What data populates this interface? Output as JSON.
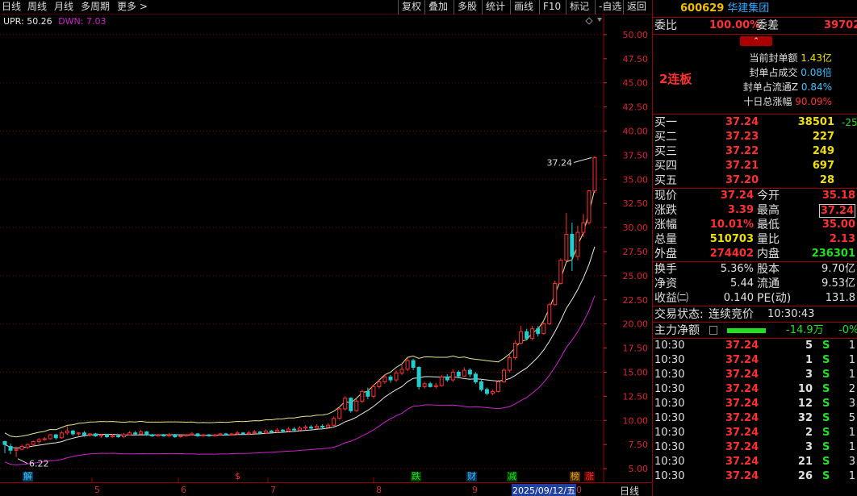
{
  "period_tabs": [
    {
      "label": "日线",
      "active": true
    },
    {
      "label": "周线",
      "active": false
    },
    {
      "label": "月线",
      "active": false
    },
    {
      "label": "多周期",
      "active": false
    },
    {
      "label": "更多 >",
      "active": false
    }
  ],
  "toolbar": [
    "复权",
    "叠加",
    "多股",
    "统计",
    "画线",
    "F10",
    "标记",
    "-自选",
    "返回"
  ],
  "indicator": {
    "upr_label": "UPR: 50.26",
    "dwn_label": "DWN: 7.03"
  },
  "colors": {
    "up": "#ff3030",
    "down": "#20d0d0",
    "upr": "#e8e890",
    "dwn": "#d020d0",
    "grid": "#800000"
  },
  "chart_data": {
    "type": "candlestick",
    "y_ticks": [
      "50.00",
      "47.50",
      "45.00",
      "42.50",
      "40.00",
      "37.50",
      "35.00",
      "32.50",
      "30.00",
      "27.50",
      "25.00",
      "22.50",
      "20.00",
      "17.50",
      "15.00",
      "12.50",
      "10.00",
      "7.50",
      "5.00"
    ],
    "ylim": [
      4.0,
      51.5
    ],
    "x_ticks": [
      "5",
      "6",
      "7",
      "8",
      "9"
    ],
    "last_price_label": "37.24",
    "low_label": "6.22",
    "candles": [
      [
        7.8,
        7.5,
        7.9,
        6.6
      ],
      [
        7.3,
        6.9,
        7.6,
        6.5
      ],
      [
        6.9,
        7.0,
        7.3,
        6.2
      ],
      [
        7.0,
        7.3,
        7.5,
        6.9
      ],
      [
        7.2,
        7.5,
        7.6,
        7.0
      ],
      [
        7.5,
        7.8,
        7.9,
        7.3
      ],
      [
        7.8,
        8.0,
        8.2,
        7.6
      ],
      [
        8.0,
        8.1,
        8.3,
        7.9
      ],
      [
        8.1,
        8.5,
        8.6,
        8.0
      ],
      [
        8.5,
        8.2,
        8.6,
        8.0
      ],
      [
        8.2,
        8.7,
        8.9,
        8.1
      ],
      [
        8.7,
        8.9,
        9.4,
        8.5
      ],
      [
        8.9,
        8.6,
        9.0,
        8.4
      ],
      [
        8.6,
        8.7,
        8.8,
        8.4
      ],
      [
        8.7,
        8.5,
        8.9,
        8.3
      ],
      [
        8.5,
        8.6,
        8.7,
        8.3
      ],
      [
        8.6,
        8.4,
        8.7,
        8.3
      ],
      [
        8.4,
        8.5,
        8.6,
        8.2
      ],
      [
        8.5,
        8.3,
        8.6,
        8.2
      ],
      [
        8.3,
        8.4,
        8.6,
        8.2
      ],
      [
        8.4,
        8.3,
        8.5,
        8.2
      ],
      [
        8.3,
        8.5,
        8.7,
        8.2
      ],
      [
        8.5,
        8.7,
        8.9,
        8.4
      ],
      [
        8.7,
        8.6,
        8.9,
        8.5
      ],
      [
        8.6,
        8.8,
        9.0,
        8.5
      ],
      [
        8.8,
        8.5,
        8.9,
        8.4
      ],
      [
        8.5,
        8.4,
        8.6,
        8.3
      ],
      [
        8.4,
        8.5,
        8.6,
        8.3
      ],
      [
        8.5,
        8.4,
        8.6,
        8.3
      ],
      [
        8.4,
        8.5,
        8.7,
        8.3
      ],
      [
        8.5,
        8.3,
        8.6,
        8.2
      ],
      [
        8.3,
        8.4,
        8.5,
        8.2
      ],
      [
        8.4,
        8.5,
        8.6,
        8.3
      ],
      [
        8.5,
        8.6,
        8.8,
        8.4
      ],
      [
        8.6,
        8.4,
        8.7,
        8.3
      ],
      [
        8.4,
        8.5,
        8.6,
        8.3
      ],
      [
        8.5,
        8.4,
        8.6,
        8.3
      ],
      [
        8.4,
        8.5,
        8.6,
        8.3
      ],
      [
        8.5,
        8.6,
        8.7,
        8.4
      ],
      [
        8.6,
        8.5,
        8.7,
        8.4
      ],
      [
        8.5,
        8.6,
        8.7,
        8.4
      ],
      [
        8.6,
        8.7,
        8.9,
        8.5
      ],
      [
        8.7,
        8.6,
        8.8,
        8.5
      ],
      [
        8.6,
        8.7,
        8.9,
        8.5
      ],
      [
        8.7,
        8.8,
        9.0,
        8.6
      ],
      [
        8.8,
        8.7,
        8.9,
        8.6
      ],
      [
        8.7,
        8.9,
        9.1,
        8.6
      ],
      [
        8.9,
        8.8,
        9.0,
        8.7
      ],
      [
        8.8,
        9.0,
        9.2,
        8.7
      ],
      [
        9.0,
        8.9,
        9.1,
        8.8
      ],
      [
        8.9,
        9.1,
        9.3,
        8.8
      ],
      [
        9.1,
        9.0,
        9.3,
        8.9
      ],
      [
        9.0,
        9.2,
        9.4,
        8.9
      ],
      [
        9.2,
        9.3,
        9.5,
        9.0
      ],
      [
        9.3,
        9.2,
        9.5,
        9.0
      ],
      [
        9.2,
        9.4,
        9.6,
        9.1
      ],
      [
        9.4,
        9.3,
        9.6,
        9.1
      ],
      [
        9.3,
        9.5,
        9.7,
        9.2
      ],
      [
        9.5,
        10.2,
        10.4,
        9.4
      ],
      [
        10.2,
        11.2,
        11.4,
        10.1
      ],
      [
        11.2,
        12.3,
        12.5,
        11.0
      ],
      [
        12.3,
        11.0,
        12.4,
        10.8
      ],
      [
        11.0,
        12.0,
        12.2,
        10.9
      ],
      [
        12.0,
        13.0,
        13.2,
        11.8
      ],
      [
        13.0,
        12.5,
        13.4,
        12.2
      ],
      [
        12.5,
        13.5,
        13.7,
        12.3
      ],
      [
        13.5,
        14.0,
        14.3,
        13.3
      ],
      [
        14.0,
        14.5,
        14.8,
        13.8
      ],
      [
        14.5,
        14.2,
        14.7,
        13.9
      ],
      [
        14.2,
        14.9,
        15.2,
        14.0
      ],
      [
        14.9,
        15.3,
        15.7,
        14.7
      ],
      [
        15.3,
        16.2,
        16.5,
        15.1
      ],
      [
        16.2,
        15.5,
        16.4,
        15.2
      ],
      [
        15.5,
        13.5,
        15.6,
        13.2
      ],
      [
        13.5,
        13.8,
        14.0,
        13.3
      ],
      [
        13.8,
        13.5,
        14.0,
        13.4
      ],
      [
        13.5,
        13.6,
        13.9,
        13.3
      ],
      [
        13.6,
        14.5,
        14.7,
        13.5
      ],
      [
        14.5,
        14.2,
        14.8,
        14.0
      ],
      [
        14.2,
        15.0,
        15.3,
        14.0
      ],
      [
        15.0,
        14.6,
        15.2,
        14.4
      ],
      [
        14.6,
        15.2,
        15.5,
        14.5
      ],
      [
        15.2,
        14.8,
        15.4,
        14.5
      ],
      [
        14.8,
        14.0,
        15.0,
        13.8
      ],
      [
        14.0,
        13.2,
        14.2,
        13.0
      ],
      [
        13.2,
        12.8,
        13.4,
        12.6
      ],
      [
        12.8,
        13.0,
        13.2,
        12.6
      ],
      [
        13.0,
        14.0,
        14.2,
        12.9
      ],
      [
        14.0,
        15.2,
        15.4,
        13.9
      ],
      [
        15.2,
        16.5,
        16.8,
        15.0
      ],
      [
        16.5,
        18.0,
        18.3,
        16.3
      ],
      [
        18.0,
        19.2,
        19.8,
        17.9
      ],
      [
        19.2,
        18.5,
        19.5,
        18.3
      ],
      [
        18.5,
        19.5,
        19.8,
        18.3
      ],
      [
        19.5,
        19.0,
        19.8,
        18.7
      ],
      [
        19.0,
        20.0,
        20.2,
        18.9
      ],
      [
        20.0,
        22.0,
        22.2,
        19.9
      ],
      [
        22.0,
        24.2,
        24.5,
        21.9
      ],
      [
        24.2,
        26.6,
        26.8,
        24.1
      ],
      [
        26.6,
        29.3,
        31.5,
        26.5
      ],
      [
        29.3,
        27.0,
        30.5,
        25.5
      ],
      [
        27.0,
        29.5,
        30.2,
        26.6
      ],
      [
        29.5,
        30.5,
        31.4,
        29.0
      ],
      [
        30.5,
        33.8,
        33.9,
        30.3
      ],
      [
        33.8,
        37.24,
        37.4,
        33.6
      ]
    ]
  },
  "event_markers": [
    {
      "label": "解",
      "color": "#40c0ff",
      "bg": "#004060",
      "x": 28
    },
    {
      "label": "$",
      "color": "#ff3030",
      "bg": "#000",
      "x": 290
    },
    {
      "label": "跌",
      "color": "#20e020",
      "bg": "#004000",
      "x": 509
    },
    {
      "label": "财",
      "color": "#40c0ff",
      "bg": "#003050",
      "x": 578
    },
    {
      "label": "减",
      "color": "#20e020",
      "bg": "#004000",
      "x": 628
    },
    {
      "label": "榜",
      "color": "#e0a020",
      "bg": "#503000",
      "x": 706
    },
    {
      "label": "涨",
      "color": "#ff3030",
      "bg": "#500000",
      "x": 724
    }
  ],
  "bottom_axis": {
    "date_label": "2025/09/12/五",
    "zero": "0",
    "timeframe": "日线"
  },
  "quote": {
    "code": "600629",
    "name": "华建集团",
    "wb_label": "委比",
    "wb_value": "100.00%",
    "wc_label": "委差",
    "wc_value": "39702",
    "limit_label": "2连板",
    "seal": [
      {
        "label": "当前封单额",
        "value": "1.43亿",
        "color": "#f0e000"
      },
      {
        "label": "封单占成交",
        "value": "0.08倍",
        "color": "#40c0ff"
      },
      {
        "label": "封单占流通Z",
        "value": "0.84%",
        "color": "#40c0ff"
      },
      {
        "label": "十日总涨幅",
        "value": "90.09%",
        "color": "#ff3030"
      }
    ],
    "buys": [
      {
        "label": "买一",
        "price": "37.24",
        "vol": "38501",
        "chg": "-25"
      },
      {
        "label": "买二",
        "price": "37.23",
        "vol": "227",
        "chg": ""
      },
      {
        "label": "买三",
        "price": "37.22",
        "vol": "249",
        "chg": ""
      },
      {
        "label": "买四",
        "price": "37.21",
        "vol": "697",
        "chg": ""
      },
      {
        "label": "买五",
        "price": "37.20",
        "vol": "28",
        "chg": ""
      }
    ],
    "stats": [
      {
        "l1": "现价",
        "v1": "37.24",
        "c1": "red",
        "l2": "今开",
        "v2": "35.18",
        "c2": "red"
      },
      {
        "l1": "涨跌",
        "v1": "3.39",
        "c1": "red",
        "l2": "最高",
        "v2": "37.24",
        "c2": "red"
      },
      {
        "l1": "涨幅",
        "v1": "10.01%",
        "c1": "red",
        "l2": "最低",
        "v2": "35.00",
        "c2": "red"
      },
      {
        "l1": "总量",
        "v1": "510703",
        "c1": "yel",
        "l2": "量比",
        "v2": "2.13",
        "c2": "red"
      },
      {
        "l1": "外盘",
        "v1": "274402",
        "c1": "red",
        "l2": "内盘",
        "v2": "236301",
        "c2": "grn"
      }
    ],
    "stats2": [
      {
        "l1": "换手",
        "v1": "5.36%",
        "l2": "股本",
        "v2": "9.70亿"
      },
      {
        "l1": "净资",
        "v1": "5.44",
        "l2": "流通",
        "v2": "9.53亿"
      },
      {
        "l1": "收益㈡",
        "v1": "0.140",
        "l2": "PE(动)",
        "v2": "131.8"
      }
    ],
    "trade_status_label": "交易状态:",
    "trade_status": "连续竞价",
    "trade_time": "10:30:43",
    "main_flow_label": "主力净额",
    "main_flow_value": "-14.9万",
    "main_flow_pct": "-0%",
    "ticks": [
      {
        "t": "10:30",
        "p": "37.24",
        "v": "5",
        "s": "S",
        "n": "1"
      },
      {
        "t": "10:30",
        "p": "37.24",
        "v": "1",
        "s": "S",
        "n": "1"
      },
      {
        "t": "10:30",
        "p": "37.24",
        "v": "3",
        "s": "S",
        "n": "1"
      },
      {
        "t": "10:30",
        "p": "37.24",
        "v": "10",
        "s": "S",
        "n": "2"
      },
      {
        "t": "10:30",
        "p": "37.24",
        "v": "12",
        "s": "S",
        "n": "3"
      },
      {
        "t": "10:30",
        "p": "37.24",
        "v": "32",
        "s": "S",
        "n": "5"
      },
      {
        "t": "10:30",
        "p": "37.24",
        "v": "2",
        "s": "S",
        "n": "1"
      },
      {
        "t": "10:30",
        "p": "37.24",
        "v": "3",
        "s": "S",
        "n": "1"
      },
      {
        "t": "10:30",
        "p": "37.24",
        "v": "21",
        "s": "S",
        "n": "3"
      },
      {
        "t": "10:30",
        "p": "37.24",
        "v": "26",
        "s": "S",
        "n": "1"
      }
    ]
  }
}
